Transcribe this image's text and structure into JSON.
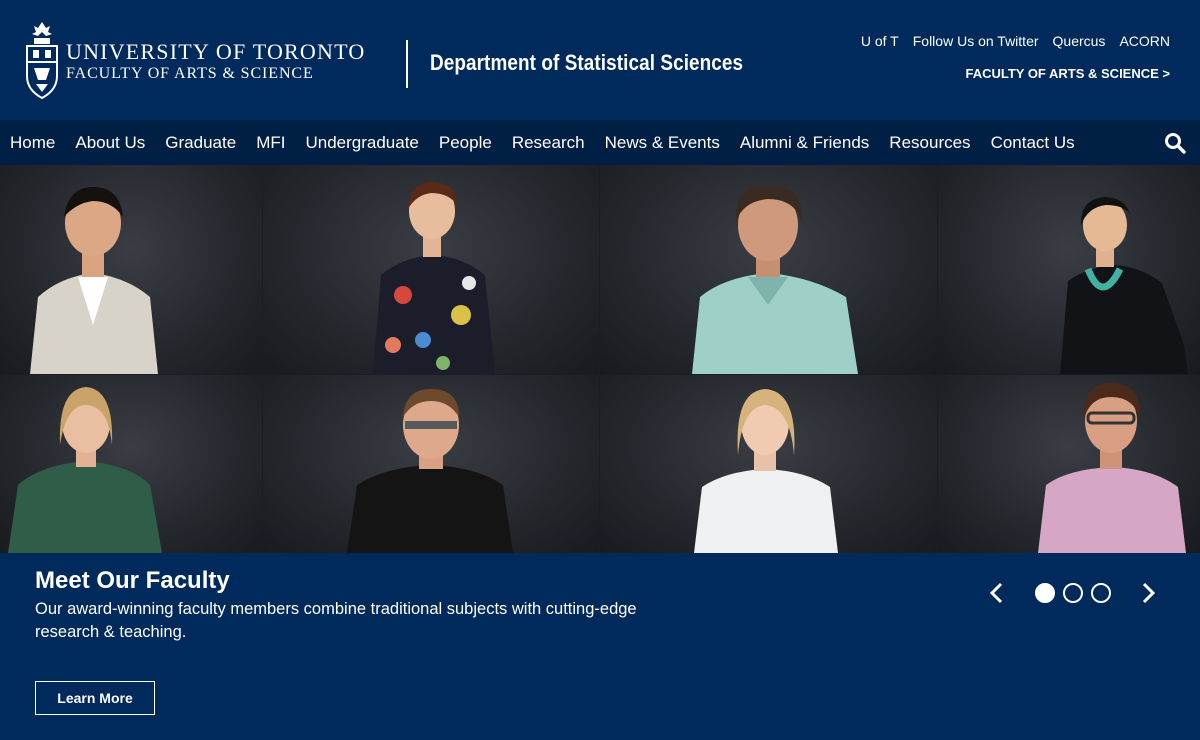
{
  "header": {
    "university_line1": "UNIVERSITY OF TORONTO",
    "university_line2": "FACULTY OF ARTS & SCIENCE",
    "department": "Department of Statistical Sciences",
    "utility_links": [
      "U of T",
      "Follow Us on Twitter",
      "Quercus",
      "ACORN"
    ],
    "faculty_link": "FACULTY OF ARTS & SCIENCE >"
  },
  "nav": {
    "items": [
      "Home",
      "About Us",
      "Graduate",
      "MFI",
      "Undergraduate",
      "People",
      "Research",
      "News & Events",
      "Alumni & Friends",
      "Resources",
      "Contact Us"
    ],
    "search_icon": "search-icon"
  },
  "hero": {
    "title": "Meet Our Faculty",
    "text": "Our award-winning faculty members combine traditional subjects with cutting-edge research & teaching.",
    "button_label": "Learn More",
    "slide_count": 3,
    "active_slide": 1
  },
  "colors": {
    "brand_navy": "#002a5c",
    "nav_navy": "#001f45",
    "text": "#ffffff"
  }
}
